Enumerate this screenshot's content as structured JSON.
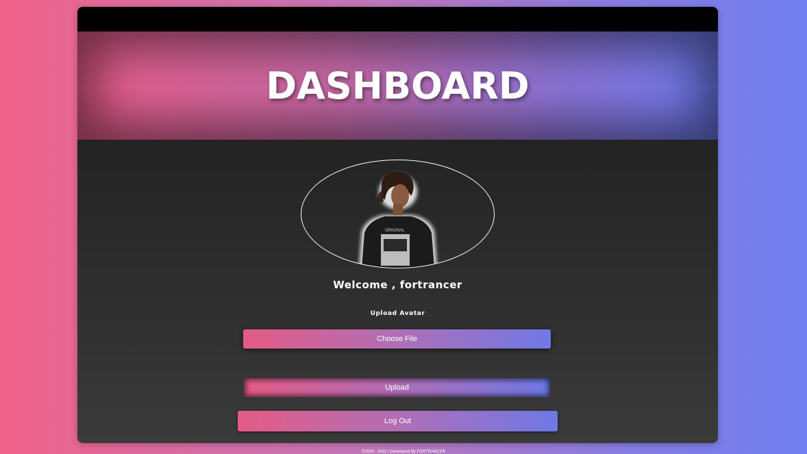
{
  "header": {
    "title": "DASHBOARD"
  },
  "profile": {
    "welcome_text": "Welcome , fortrancer",
    "avatar_icon": "avatar-photo"
  },
  "upload": {
    "label": "Upload Avatar",
    "choose_file_label": "Choose File",
    "upload_label": "Upload"
  },
  "actions": {
    "logout_label": "Log Out"
  },
  "footer": {
    "text": "©2020 - 2022 | Developed By FORTRANCER"
  },
  "colors": {
    "accent_pink": "#ec5f8c",
    "accent_purple": "#8d74d8",
    "accent_blue": "#6f7cf0",
    "card_dark": "#1a1a1a"
  }
}
